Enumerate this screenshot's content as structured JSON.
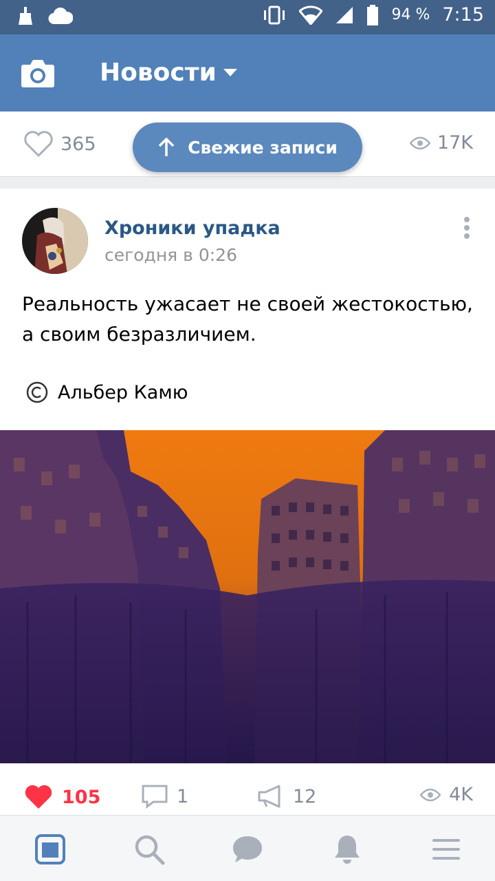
{
  "status_bar": {
    "battery": "94 %",
    "time": "7:15"
  },
  "header": {
    "title": "Новости"
  },
  "stats_strip": {
    "likes": "365",
    "views": "17K",
    "fresh_button_label": "Свежие записи"
  },
  "post": {
    "author": "Хроники упадка",
    "time": "сегодня в 0:26",
    "text": "Реальность ужасает не своей жестокостью, а своим безразличием.",
    "quote_author": "Альбер Камю",
    "likes": "105",
    "comments": "1",
    "reposts": "12",
    "views": "4K"
  },
  "colors": {
    "header": "#5181b8",
    "status_bar": "#42628a",
    "link": "#2a5885",
    "like_active": "#ff3347",
    "muted": "#828a99"
  },
  "bottom_nav": {
    "items": [
      "news-icon",
      "search-icon",
      "messages-icon",
      "notifications-icon",
      "menu-icon"
    ]
  }
}
